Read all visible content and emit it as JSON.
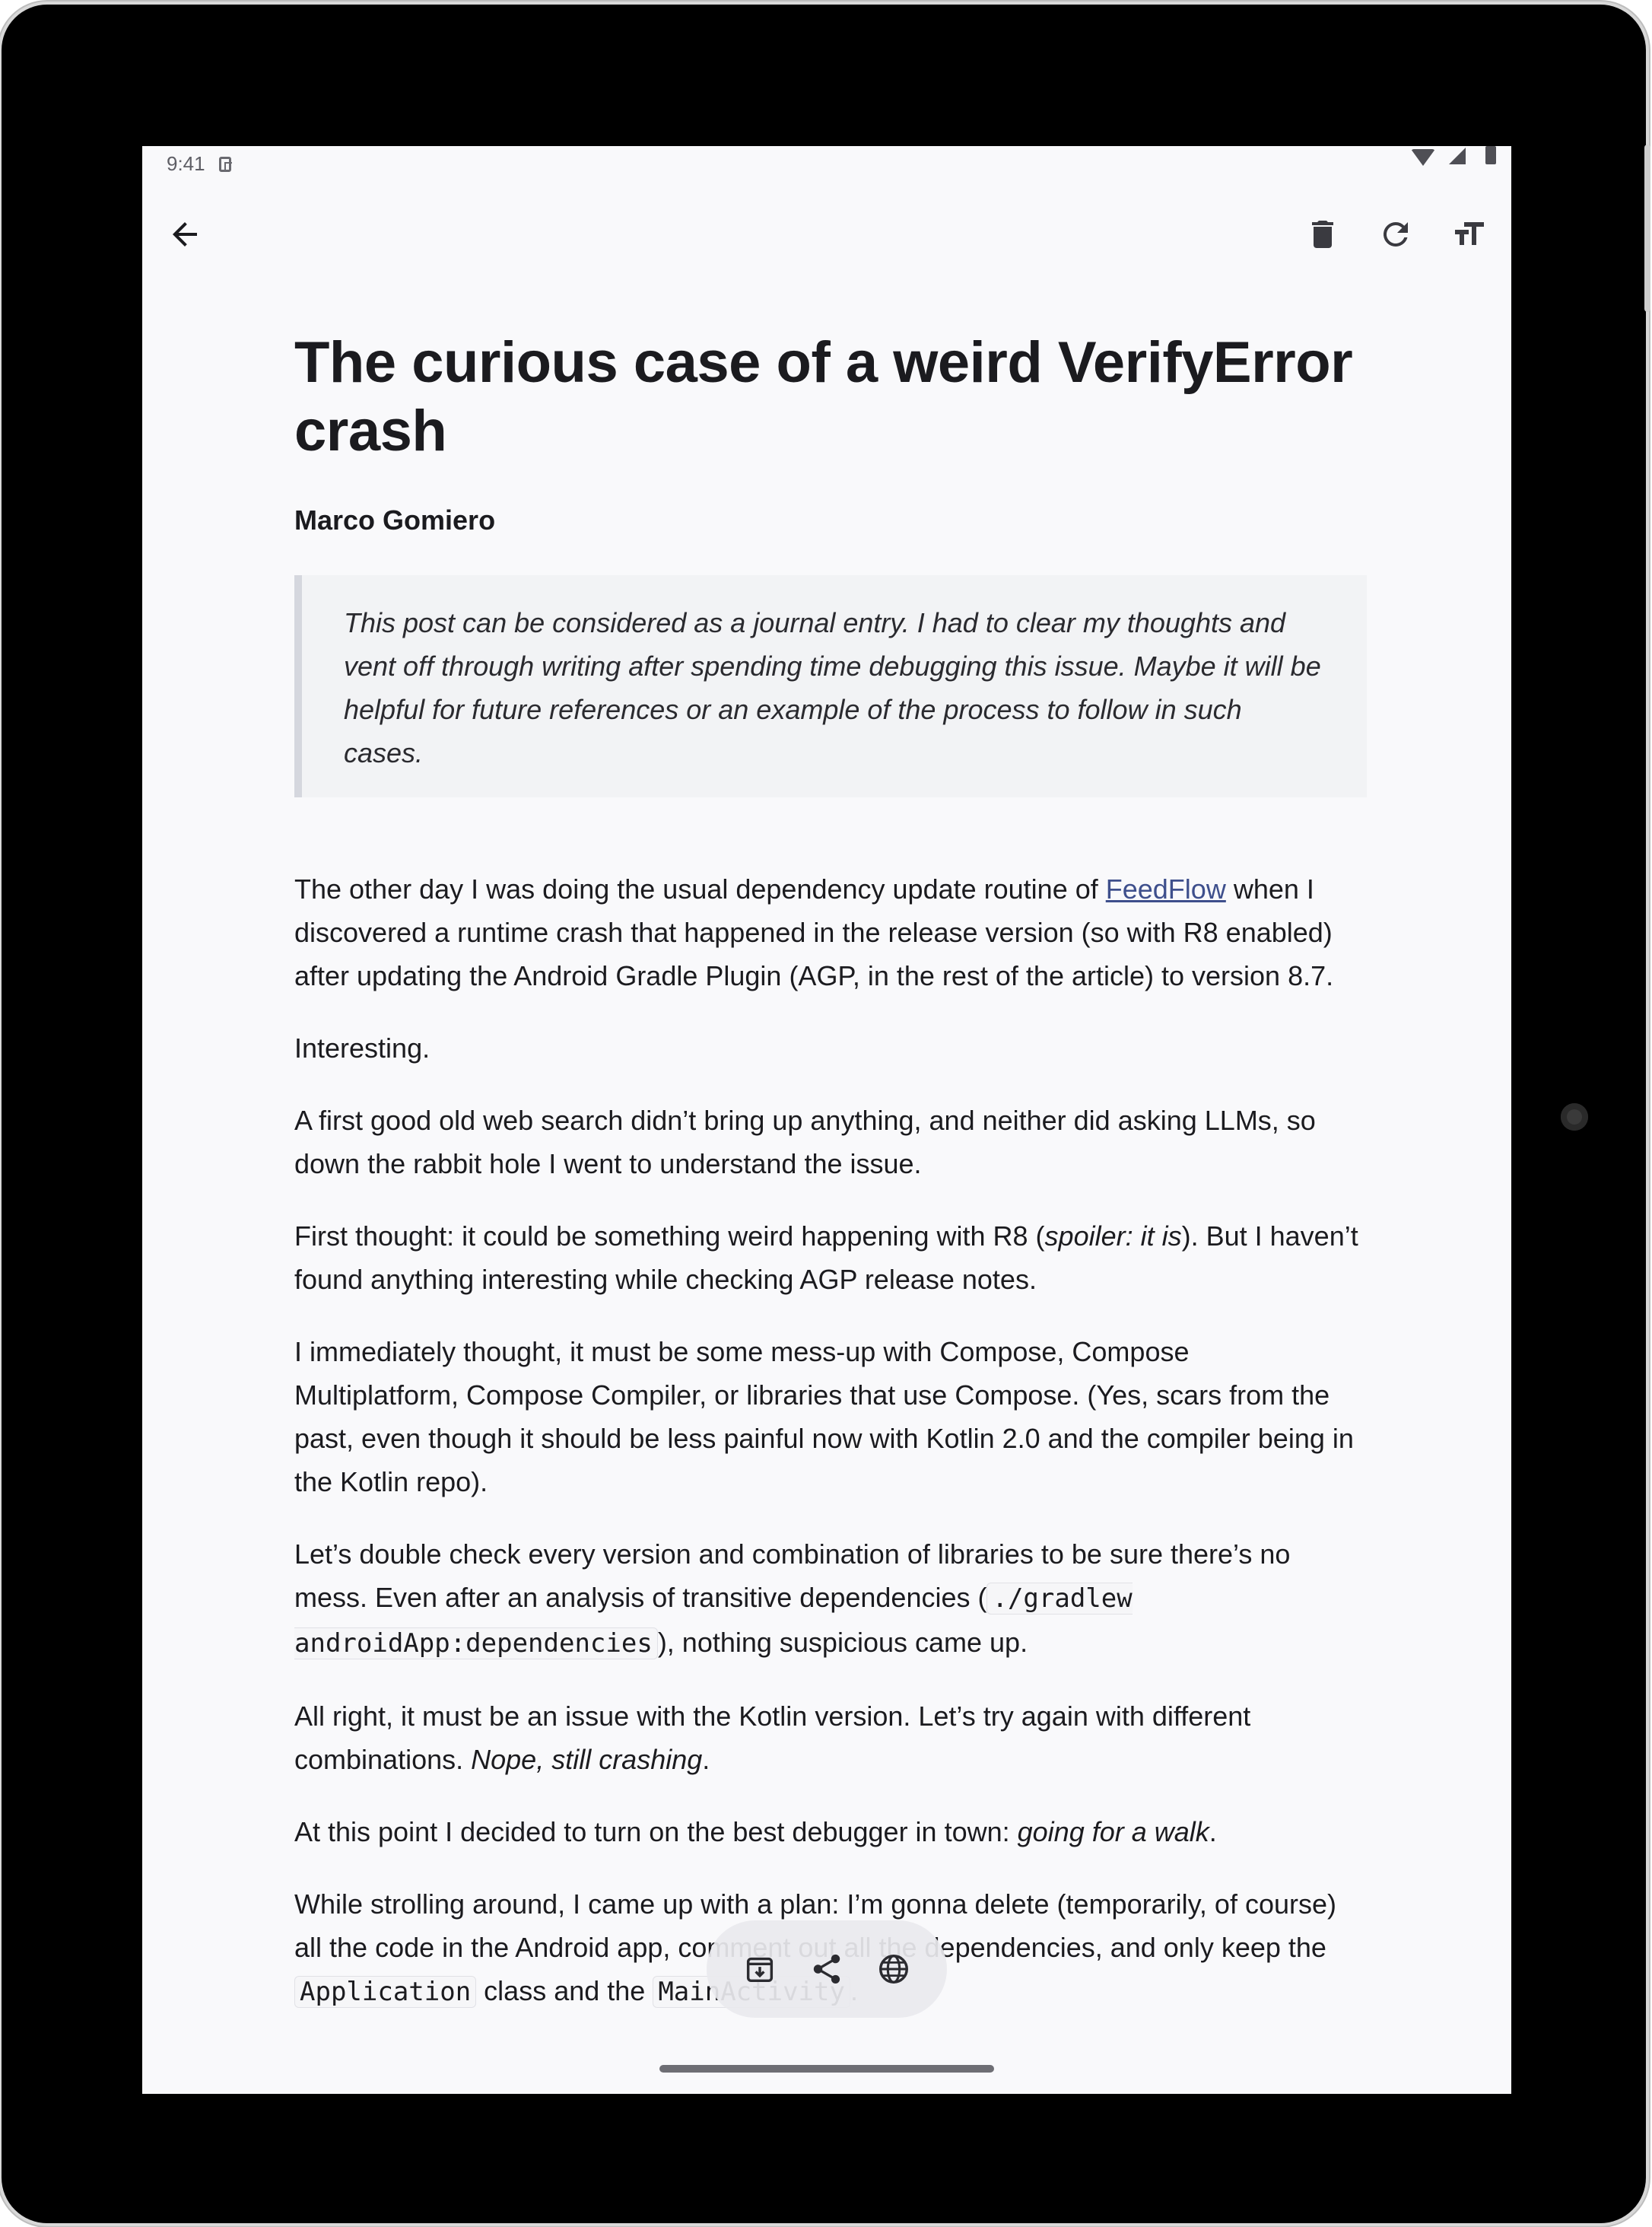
{
  "status_bar": {
    "time": "9:41"
  },
  "toolbar": {
    "icons": [
      "back-arrow-icon",
      "delete-icon",
      "refresh-icon",
      "text-size-icon"
    ]
  },
  "article": {
    "title": "The curious case of a weird VerifyError crash",
    "author": "Marco Gomiero",
    "quote": "This post can be considered as a journal entry. I had to clear my thoughts and vent off through writing after spending time debugging this issue. Maybe it will be helpful for future references or an example of the process to follow in such cases.",
    "p1_a": "The other day I was doing the usual dependency update routine of ",
    "p1_link": "FeedFlow",
    "p1_b": " when I discovered a runtime crash that happened in the release version (so with R8 enabled) after updating the Android Gradle Plugin (AGP, in the rest of the article) to version 8.7.",
    "p2": "Interesting.",
    "p3": "A first good old web search didn’t bring up anything, and neither did asking LLMs, so down the rabbit hole I went to understand the issue.",
    "p4_a": "First thought: it could be something weird happening with R8 (",
    "p4_em": "spoiler: it is",
    "p4_b": "). But I haven’t found anything interesting while checking AGP release notes.",
    "p5": "I immediately thought, it must be some mess-up with Compose, Compose Multiplatform, Compose Compiler, or libraries that use Compose. (Yes, scars from the past, even though it should be less painful now with Kotlin 2.0 and the compiler being in the Kotlin repo).",
    "p6_a": "Let’s double check every version and combination of libraries to be sure there’s no mess. Even after an analysis of transitive dependencies (",
    "p6_code": "./gradlew androidApp:dependencies",
    "p6_b": "), nothing suspicious came up.",
    "p7_a": "All right, it must be an issue with the Kotlin version. Let’s try again with different combinations. ",
    "p7_em": "Nope, still crashing",
    "p7_b": ".",
    "p8_a": "At this point I decided to turn on the best debugger in town: ",
    "p8_em": "going for a walk",
    "p8_b": ".",
    "p9_a": "While strolling around, I came up with a plan: I’m gonna delete (temporarily, of course) all the code in the Android app, comment out all the dependencies, and only keep the ",
    "p9_code1": "Application",
    "p9_mid": " class and the ",
    "p9_code2": "MainActivity",
    "p9_b": "."
  },
  "bottom_bar": {
    "icons": [
      "save-offline-icon",
      "share-icon",
      "open-in-browser-icon"
    ]
  }
}
